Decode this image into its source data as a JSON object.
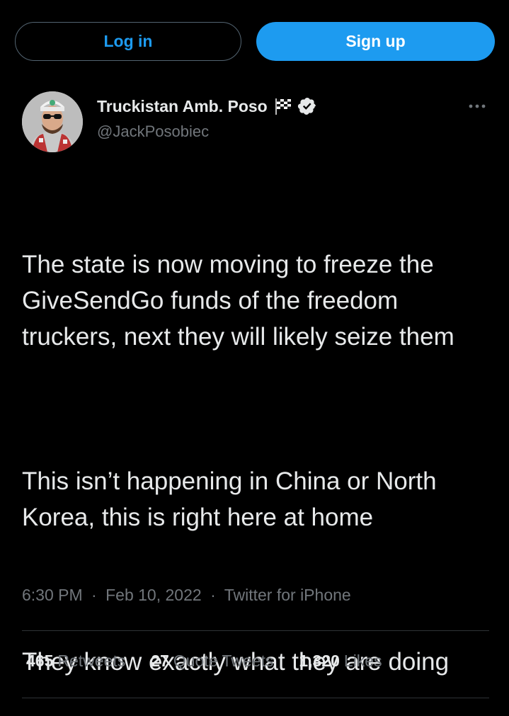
{
  "header": {
    "login_label": "Log in",
    "signup_label": "Sign up"
  },
  "tweet": {
    "author_name": "Truckistan Amb. Poso",
    "handle": "@JackPosobiec",
    "paragraphs": [
      "The state is now moving to freeze the GiveSendGo funds of the freedom truckers, next they will likely seize them",
      "This isn’t happening in China or North Korea, this is right here at home",
      "They know exactly what they are doing"
    ],
    "time": "6:30 PM",
    "date": "Feb 10, 2022",
    "source": "Twitter for iPhone",
    "separator": "·"
  },
  "stats": {
    "retweets_count": "465",
    "retweets_label": "Retweets",
    "quotes_count": "27",
    "quotes_label": "Quote Tweets",
    "likes_count": "1,320",
    "likes_label": "Likes"
  },
  "icons": {
    "flag": "checkered-flag-icon",
    "verified": "verified-badge-icon",
    "more": "more-options-icon"
  },
  "colors": {
    "accent": "#1d9bf0",
    "background": "#000000",
    "text": "#e7e9ea",
    "muted": "#71767b"
  }
}
